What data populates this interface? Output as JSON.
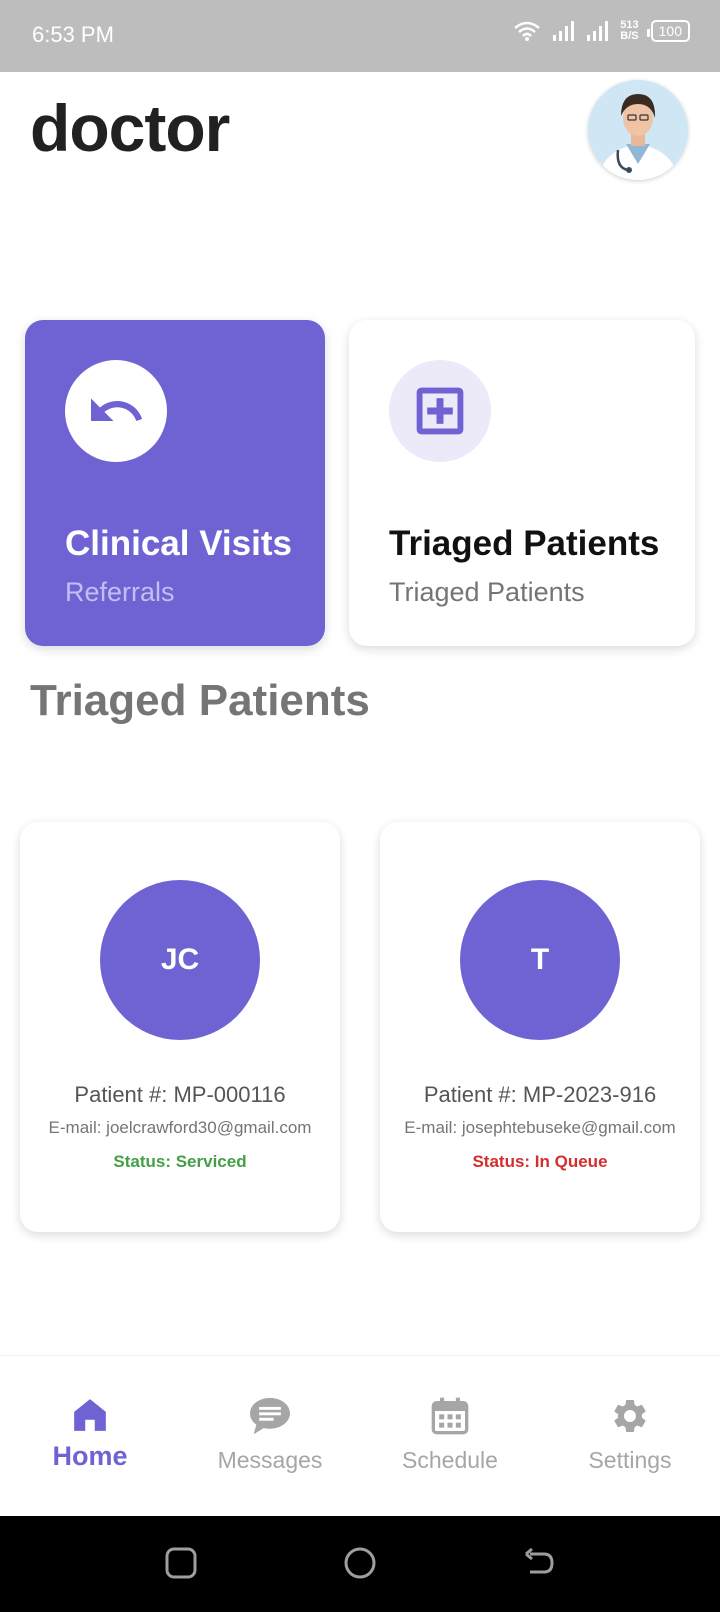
{
  "status_bar": {
    "time": "6:53 PM",
    "net_speed_value": "513",
    "net_speed_unit": "B/S",
    "battery": "100"
  },
  "header": {
    "title": "doctor",
    "avatar_icon": "doctor-avatar-icon"
  },
  "cards": [
    {
      "title": "Clinical Visits",
      "subtitle": "Referrals",
      "icon": "undo-arrow-icon"
    },
    {
      "title": "Triaged Patients",
      "subtitle": "Triaged Patients",
      "icon": "medical-plus-icon"
    }
  ],
  "section": {
    "title": "Triaged Patients"
  },
  "patients": [
    {
      "initials": "JC",
      "number": "Patient #: MP-000116",
      "email": "E-mail: joelcrawford30@gmail.com",
      "status": "Status: Serviced",
      "status_color": "#43a047"
    },
    {
      "initials": "T",
      "number": "Patient #: MP-2023-916",
      "email": "E-mail: josephtebuseke@gmail.com",
      "status": "Status: In Queue",
      "status_color": "#d32f2f"
    }
  ],
  "nav": [
    {
      "label": "Home",
      "icon": "home-icon",
      "active": true
    },
    {
      "label": "Messages",
      "icon": "chat-icon",
      "active": false
    },
    {
      "label": "Schedule",
      "icon": "calendar-icon",
      "active": false
    },
    {
      "label": "Settings",
      "icon": "gear-icon",
      "active": false
    }
  ],
  "colors": {
    "accent": "#6f63d4",
    "status_bar": "#bdbdbd"
  }
}
